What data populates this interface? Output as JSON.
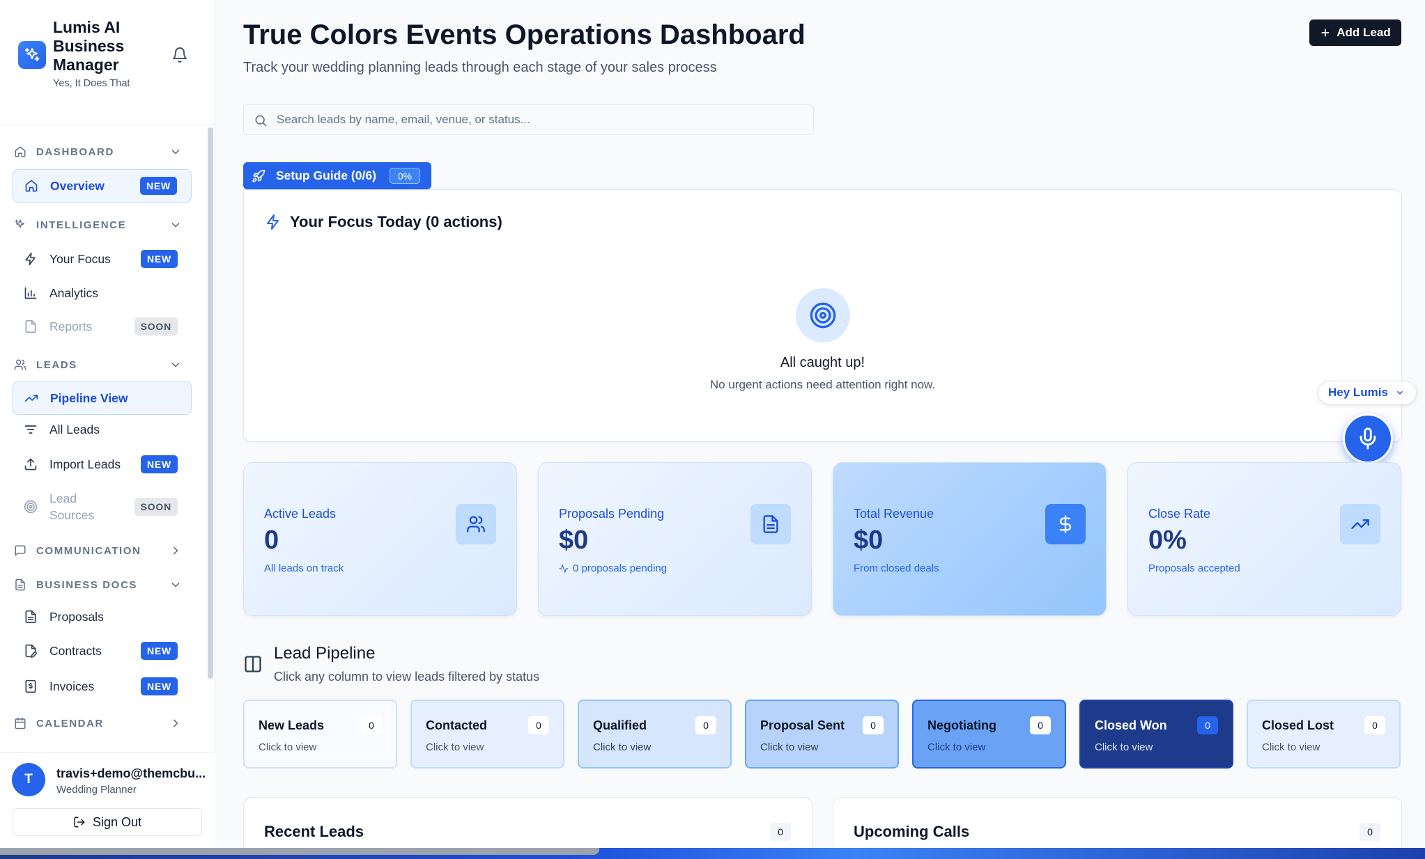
{
  "brand": {
    "title": "Lumis AI Business Manager",
    "tagline": "Yes, It Does That"
  },
  "sidebar": {
    "sections": {
      "dashboard": "DASHBOARD",
      "intelligence": "INTELLIGENCE",
      "leads": "LEADS",
      "communication": "COMMUNICATION",
      "business_docs": "BUSINESS DOCS",
      "calendar": "CALENDAR"
    },
    "items": {
      "overview": {
        "label": "Overview",
        "badge": "NEW"
      },
      "your_focus": {
        "label": "Your Focus",
        "badge": "NEW"
      },
      "analytics": {
        "label": "Analytics"
      },
      "reports": {
        "label": "Reports",
        "badge": "SOON"
      },
      "pipeline_view": {
        "label": "Pipeline View"
      },
      "all_leads": {
        "label": "All Leads"
      },
      "import_leads": {
        "label": "Import Leads",
        "badge": "NEW"
      },
      "lead_sources": {
        "label": "Lead Sources",
        "badge": "SOON"
      },
      "proposals": {
        "label": "Proposals"
      },
      "contracts": {
        "label": "Contracts",
        "badge": "NEW"
      },
      "invoices": {
        "label": "Invoices",
        "badge": "NEW"
      }
    }
  },
  "user": {
    "initial": "T",
    "email": "travis+demo@themcbu...",
    "role": "Wedding Planner",
    "sign_out": "Sign Out"
  },
  "header": {
    "title": "True Colors Events Operations Dashboard",
    "subtitle": "Track your wedding planning leads through each stage of your sales process",
    "add_lead": "Add Lead"
  },
  "search": {
    "placeholder": "Search leads by name, email, venue, or status...",
    "value": ""
  },
  "setup_guide": {
    "label": "Setup Guide (0/6)",
    "percent": "0%"
  },
  "focus": {
    "title": "Your Focus Today (0 actions)",
    "empty_title": "All caught up!",
    "empty_sub": "No urgent actions need attention right now."
  },
  "assistant": {
    "label": "Hey Lumis"
  },
  "stats": [
    {
      "label": "Active Leads",
      "value": "0",
      "sub": "All leads on track",
      "icon": "users-icon"
    },
    {
      "label": "Proposals Pending",
      "value": "$0",
      "sub": "0 proposals pending",
      "icon": "document-icon"
    },
    {
      "label": "Total Revenue",
      "value": "$0",
      "sub": "From closed deals",
      "icon": "dollar-icon"
    },
    {
      "label": "Close Rate",
      "value": "0%",
      "sub": "Proposals accepted",
      "icon": "trending-up-icon"
    }
  ],
  "pipeline": {
    "title": "Lead Pipeline",
    "subtitle": "Click any column to view leads filtered by status",
    "stages": [
      {
        "name": "New Leads",
        "count": "0",
        "hint": "Click to view"
      },
      {
        "name": "Contacted",
        "count": "0",
        "hint": "Click to view"
      },
      {
        "name": "Qualified",
        "count": "0",
        "hint": "Click to view"
      },
      {
        "name": "Proposal Sent",
        "count": "0",
        "hint": "Click to view"
      },
      {
        "name": "Negotiating",
        "count": "0",
        "hint": "Click to view"
      },
      {
        "name": "Closed Won",
        "count": "0",
        "hint": "Click to view"
      },
      {
        "name": "Closed Lost",
        "count": "0",
        "hint": "Click to view"
      }
    ]
  },
  "recent_leads": {
    "title": "Recent Leads",
    "count": "0"
  },
  "upcoming_calls": {
    "title": "Upcoming Calls",
    "count": "0"
  },
  "colors": {
    "accent": "#2563eb",
    "dark_button": "#111827",
    "closed_won": "#1e3a8a"
  }
}
